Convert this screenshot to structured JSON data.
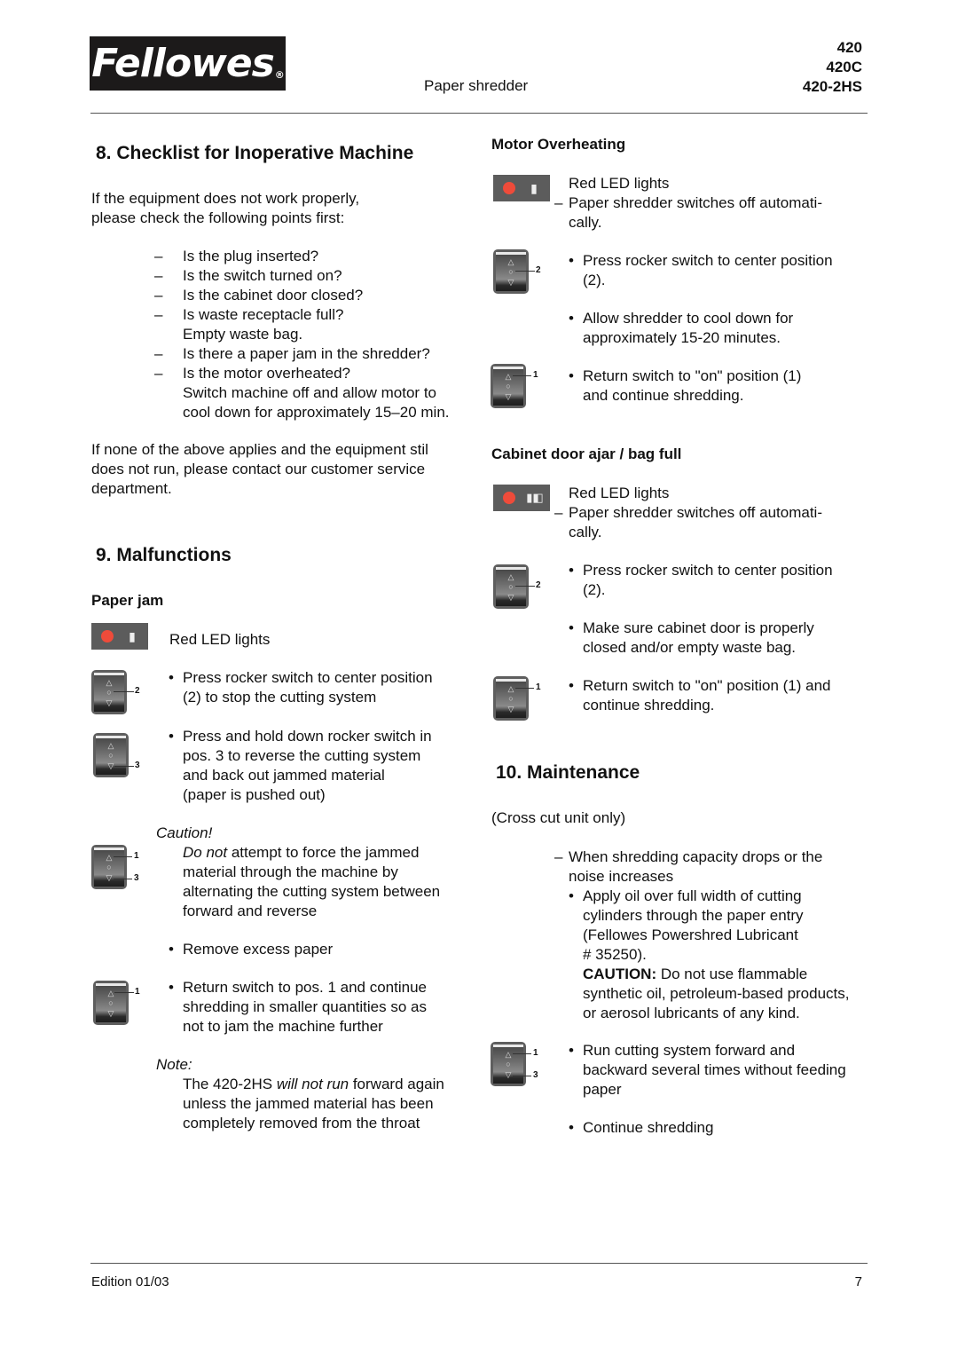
{
  "header": {
    "brand": "Fellowes",
    "registered_mark": "®",
    "subtitle": "Paper shredder",
    "models": [
      "420",
      "420C",
      "420-2HS"
    ]
  },
  "section8": {
    "title": "8.   Checklist for Inoperative Machine",
    "intro": [
      "If  the equipment does not work properly,",
      "please check the following points first:"
    ],
    "checklist": [
      {
        "dash": "–",
        "lines": [
          "Is the plug inserted?"
        ]
      },
      {
        "dash": "–",
        "lines": [
          "Is the switch turned on?"
        ]
      },
      {
        "dash": "–",
        "lines": [
          "Is the cabinet door closed?"
        ]
      },
      {
        "dash": "–",
        "lines": [
          "Is waste receptacle full?",
          "Empty waste bag."
        ]
      },
      {
        "dash": "–",
        "lines": [
          "Is there a paper jam in the shredder?"
        ]
      },
      {
        "dash": "–",
        "lines": [
          "Is the motor overheated?",
          "Switch machine off and allow motor to",
          "cool down for approximately 15–20 min."
        ]
      }
    ],
    "outro": [
      "If none of the above applies and the equipment stil",
      "does not run, please contact our customer service",
      "department."
    ]
  },
  "section9": {
    "title": "9.   Malfunctions",
    "paper_jam": {
      "heading": "Paper jam",
      "led_text": "Red LED lights",
      "steps": [
        {
          "bullet": "•",
          "lines": [
            "Press rocker switch to center position",
            "(2) to stop the cutting system"
          ],
          "switch_labels": [
            "2"
          ]
        },
        {
          "bullet": "•",
          "lines": [
            "Press and hold down rocker switch in",
            "pos. 3 to reverse the cutting system",
            "and back out jammed material",
            "(paper is pushed out)"
          ],
          "switch_labels": [
            "3"
          ]
        }
      ],
      "caution_label": "Caution!",
      "caution_emph": "Do not",
      "caution_lines": [
        " attempt to force the jammed",
        "material through the machine by",
        "alternating the cutting system between",
        "forward and reverse"
      ],
      "caution_switch_labels": [
        "1",
        "3"
      ],
      "remove_step": {
        "bullet": "•",
        "text": "Remove excess paper"
      },
      "return_step": {
        "bullet": "•",
        "lines": [
          "Return switch to pos. 1 and continue",
          "shredding in smaller quantities so as",
          "not to jam the machine further"
        ],
        "switch_labels": [
          "1"
        ]
      },
      "note_label": "Note:",
      "note_pre": "The 420-2HS ",
      "note_emph": "will not run",
      "note_post": " forward again",
      "note_lines": [
        "unless the jammed material has been",
        "completely removed from the throat"
      ]
    }
  },
  "motor_overheating": {
    "heading": "Motor Overheating",
    "led_text": "Red LED lights",
    "dash": "–",
    "led_desc": [
      "Paper shredder switches off automati-",
      "cally."
    ],
    "steps": [
      {
        "bullet": "•",
        "lines": [
          "Press rocker switch to center position",
          "(2)."
        ],
        "switch_labels": [
          "2"
        ]
      },
      {
        "bullet": "•",
        "lines": [
          "Allow shredder to cool down for",
          "approximately 15-20 minutes."
        ]
      },
      {
        "bullet": "•",
        "lines": [
          "Return switch to \"on\" position (1)",
          "and continue shredding."
        ],
        "switch_labels": [
          "1"
        ]
      }
    ]
  },
  "cabinet_door": {
    "heading": "Cabinet door ajar / bag full",
    "led_text": "Red LED lights",
    "dash": "–",
    "led_desc": [
      "Paper shredder switches off automati-",
      "cally."
    ],
    "steps": [
      {
        "bullet": "•",
        "lines": [
          "Press rocker switch to center position",
          "(2)."
        ],
        "switch_labels": [
          "2"
        ]
      },
      {
        "bullet": "•",
        "lines": [
          "Make sure cabinet door is properly",
          "closed and/or empty waste bag."
        ]
      },
      {
        "bullet": "•",
        "lines": [
          "Return switch to \"on\" position (1) and",
          "continue shredding."
        ],
        "switch_labels": [
          "1"
        ]
      }
    ]
  },
  "section10": {
    "title": "10. Maintenance",
    "scope": "(Cross cut unit only)",
    "dash": "–",
    "condition": [
      "When shredding capacity drops or the",
      "noise increases"
    ],
    "oil_step": {
      "bullet": "•",
      "lines": [
        "Apply oil over full width of cutting",
        "cylinders through the paper entry",
        "(Fellowes Powershred Lubricant",
        "# 35250)."
      ]
    },
    "caution_label": "CAUTION:",
    "caution_text": " Do not use flammable",
    "caution_lines": [
      "synthetic oil, petroleum-based products,",
      "or aerosol lubricants of any kind."
    ],
    "run_step": {
      "bullet": "•",
      "lines": [
        "Run cutting system forward and",
        "backward several times without feeding",
        "paper"
      ],
      "switch_labels": [
        "1",
        "3"
      ]
    },
    "continue_step": {
      "bullet": "•",
      "text": "Continue shredding"
    }
  },
  "footer": {
    "edition": "Edition 01/03",
    "page_number": "7"
  },
  "colors": {
    "led_red": "#ef4b3a",
    "panel_gray": "#5c5c5c",
    "logo_bg": "#1c1a1a"
  }
}
